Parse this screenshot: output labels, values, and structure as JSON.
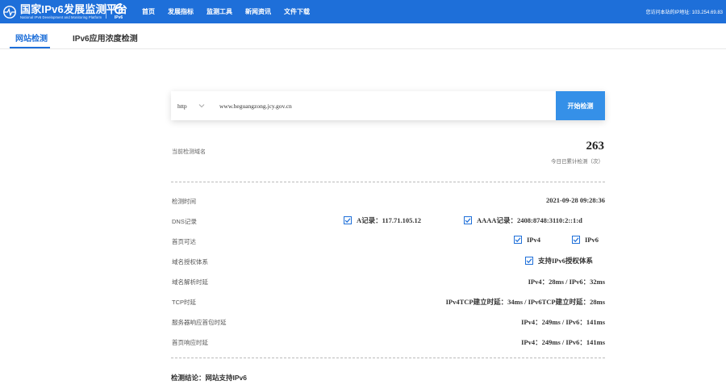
{
  "header": {
    "brand_title": "国家IPv6发展监测平台",
    "brand_subtitle": "National IPv6 Development and Monitoring Platform",
    "badge_text": "IPv6",
    "nav": [
      "首页",
      "发展指标",
      "监测工具",
      "新闻资讯",
      "文件下载"
    ],
    "visitor_ip_text": "您访问本站的IP地址: 103.254.69.83",
    "bar_color": "#1e6fd9"
  },
  "tabs": [
    {
      "label": "网站检测",
      "active": true
    },
    {
      "label": "IPv6应用浓度检测",
      "active": false
    }
  ],
  "search": {
    "protocol": "http",
    "url_value": "www.heguangzong.jcy.gov.cn",
    "button_label": "开始检测",
    "button_color": "#3590e8"
  },
  "summary": {
    "current_domain_label": "当前检测域名",
    "today_count": "263",
    "today_count_label": "今日已累计检测（次）"
  },
  "results": {
    "check_time": {
      "label": "检测时间",
      "value": "2021-09-28 09:28:36"
    },
    "dns": {
      "label": "DNS记录",
      "a_record": "A记录：117.71.105.12",
      "aaaa_record": "AAAA记录：2408:8748:3110:2::1:d"
    },
    "homepage_reach": {
      "label": "首页可达",
      "ipv4": "IPv4",
      "ipv6": "IPv6"
    },
    "auth": {
      "label": "域名授权体系",
      "value": "支持IPv6授权体系"
    },
    "dns_latency": {
      "label": "域名解析时延",
      "value": "IPv4：28ms / IPv6：32ms"
    },
    "tcp": {
      "label": "TCP时延",
      "value": "IPv4TCP建立时延：34ms / IPv6TCP建立时延：28ms"
    },
    "server_first_packet": {
      "label": "服务器响应首包时延",
      "value": "IPv4：249ms / IPv6：141ms"
    },
    "homepage_response": {
      "label": "首页响应时延",
      "value": "IPv4：249ms / IPv6：141ms"
    }
  },
  "conclusion": "检测结论：网站支持IPv6"
}
